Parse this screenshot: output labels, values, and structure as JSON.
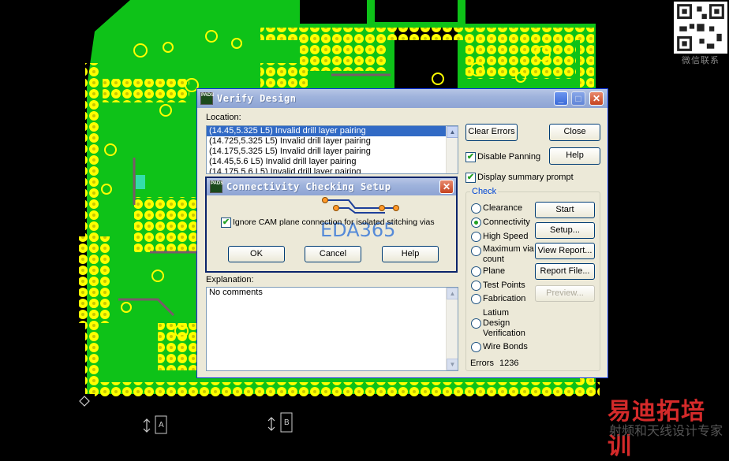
{
  "watermark": {
    "qr_caption": "微信联系",
    "brand_overlay": "EDA365",
    "brand_cn": "易迪拓培训",
    "brand_cn_sub": "射频和天线设计专家"
  },
  "board_markers": [
    "A",
    "B"
  ],
  "verify": {
    "title": "Verify Design",
    "location_label": "Location:",
    "locations": [
      "(14.45,5.325 L5) Invalid drill layer pairing",
      "(14.725,5.325 L5) Invalid drill layer pairing",
      "(14.175,5.325 L5) Invalid drill layer pairing",
      "(14.45,5.6 L5) Invalid drill layer pairing",
      "(14.175,5.6 L5) Invalid drill layer pairing"
    ],
    "buttons": {
      "clear_errors": "Clear Errors",
      "close": "Close",
      "help": "Help",
      "start": "Start",
      "setup": "Setup...",
      "view_report": "View Report...",
      "report_file": "Report File...",
      "preview": "Preview..."
    },
    "disable_panning": "Disable Panning",
    "display_summary": "Display summary prompt",
    "check_label": "Check",
    "check_options": [
      "Clearance",
      "Connectivity",
      "High Speed",
      "Maximum via count",
      "Plane",
      "Test Points",
      "Fabrication",
      "Latium Design Verification",
      "Wire Bonds"
    ],
    "selected_check": "Connectivity",
    "explanation_label": "Explanation:",
    "explanation_text": "No comments",
    "errors_label": "Errors",
    "errors_count": "1236"
  },
  "connectivity": {
    "title": "Connectivity Checking Setup",
    "ignore_cam": "Ignore CAM plane connection for isolated stitching vias",
    "ok": "OK",
    "cancel": "Cancel",
    "help": "Help"
  },
  "colors": {
    "board": "#0ec218",
    "via": "#ffff00",
    "titlebar": "#9fb3dc",
    "dialog_bg": "#ece9d8",
    "brand": "#d42a2a"
  },
  "icons": [
    "pads-icon",
    "minimize-icon",
    "maximize-icon",
    "close-icon",
    "qr-code-icon"
  ]
}
